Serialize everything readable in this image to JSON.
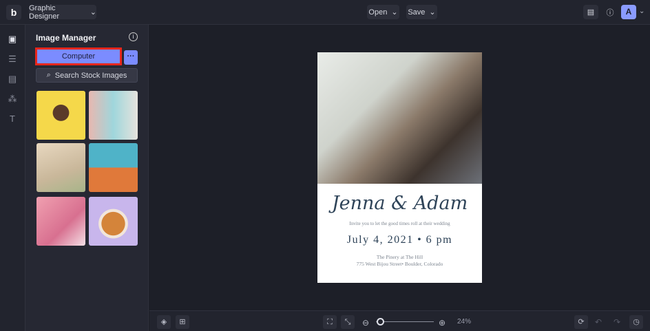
{
  "header": {
    "app_menu": "Graphic Designer",
    "open": "Open",
    "save": "Save",
    "avatar": "A"
  },
  "panel": {
    "title": "Image Manager",
    "computer": "Computer",
    "more": "···",
    "search": "Search Stock Images"
  },
  "document": {
    "names": "Jenna & Adam",
    "invite": "Invite you to let the good times roll at their wedding",
    "date": "July 4, 2021 • 6 pm",
    "venue": "The Pinery at The Hill",
    "address": "775 West Bijou Street• Boulder, Colorado"
  },
  "footer": {
    "zoom": "24%",
    "zoom_fraction": 0.05
  },
  "colors": {
    "accent": "#7b8cff",
    "highlight": "#e8261c"
  }
}
